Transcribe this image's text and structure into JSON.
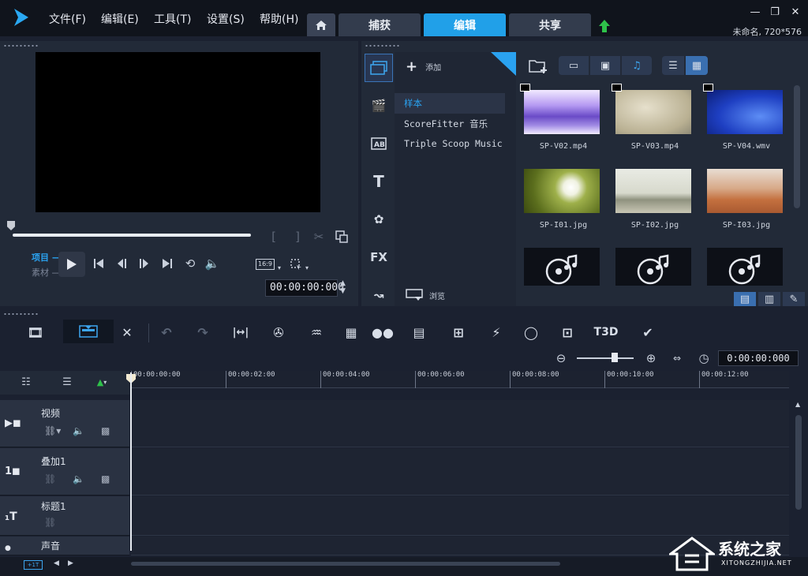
{
  "app": {
    "menu": [
      "文件(F)",
      "编辑(E)",
      "工具(T)",
      "设置(S)",
      "帮助(H)"
    ],
    "tabs": [
      "捕获",
      "编辑",
      "共享"
    ],
    "active_tab": "编辑",
    "project_info": "未命名, 720*576"
  },
  "preview": {
    "mode_project": "项目",
    "mode_clip": "素材",
    "aspect_ratio": "16:9",
    "timecode": "00:00:00:000"
  },
  "library": {
    "add_label": "添加",
    "folders": [
      "样本",
      "ScoreFitter 音乐",
      "Triple Scoop Music"
    ],
    "selected_folder": "样本",
    "browse_label": "浏览",
    "thumbnails": [
      {
        "name": "SP-V02.mp4",
        "type": "video"
      },
      {
        "name": "SP-V03.mp4",
        "type": "video"
      },
      {
        "name": "SP-V04.wmv",
        "type": "video"
      },
      {
        "name": "SP-I01.jpg",
        "type": "image"
      },
      {
        "name": "SP-I02.jpg",
        "type": "image"
      },
      {
        "name": "SP-I03.jpg",
        "type": "image"
      },
      {
        "name": "",
        "type": "audio"
      },
      {
        "name": "",
        "type": "audio"
      },
      {
        "name": "",
        "type": "audio"
      }
    ],
    "category_labels": {
      "fx": "FX"
    }
  },
  "timeline": {
    "timecode": "0:00:00:000",
    "ruler": [
      "00:00:00:00",
      "00:00:02:00",
      "00:00:04:00",
      "00:00:06:00",
      "00:00:08:00",
      "00:00:10:00",
      "00:00:12:00"
    ],
    "tracks": [
      {
        "name": "视频",
        "icon": "video-track-icon"
      },
      {
        "name": "叠加1",
        "icon": "overlay-track-icon"
      },
      {
        "name": "标题1",
        "icon": "title-track-icon"
      },
      {
        "name": "声音",
        "icon": "voice-track-icon"
      }
    ],
    "tool_3d": "T3D"
  },
  "watermark": {
    "title": "系统之家",
    "url": "XITONGZHIJIA.NET"
  },
  "colors": {
    "accent": "#21a0e8",
    "background": "#1b2130",
    "titlebar": "#10141c",
    "upload_arrow": "#2ec24a"
  }
}
